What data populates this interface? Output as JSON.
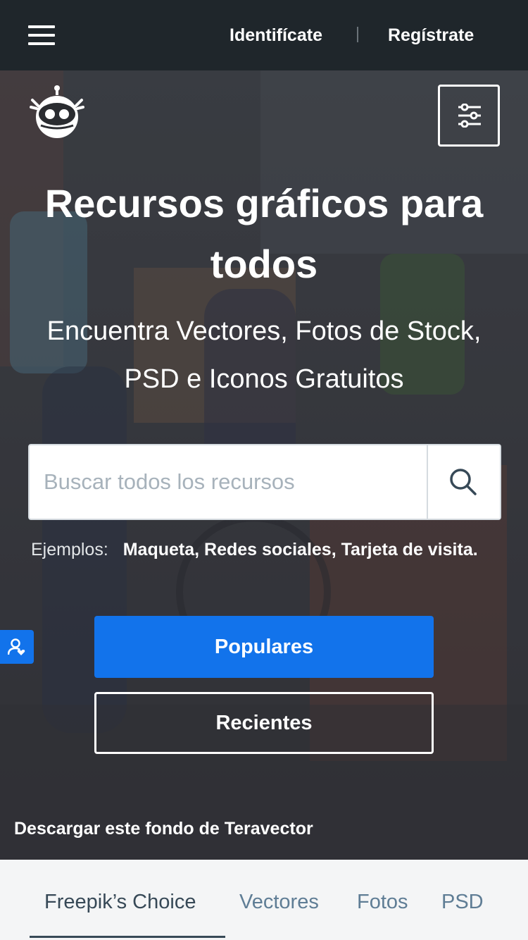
{
  "topbar": {
    "menu_icon": "hamburger-menu-icon",
    "login_label": "Identifícate",
    "register_label": "Regístrate"
  },
  "hero": {
    "logo_icon": "freepik-robot-logo-icon",
    "filter_icon": "sliders-icon",
    "title": "Recursos gráficos para todos",
    "subtitle": "Encuentra Vectores, Fotos de Stock, PSD e Iconos Gratuitos",
    "search": {
      "placeholder": "Buscar todos los recursos",
      "value": "",
      "button_icon": "search-icon"
    },
    "examples": {
      "label": "Ejemplos:",
      "items": [
        "Maqueta",
        "Redes sociales",
        "Tarjeta de visita"
      ],
      "separators": [
        ", ",
        ", ",
        "."
      ]
    },
    "user_tab_icon": "user-heart-icon",
    "popular_label": "Populares",
    "recent_label": "Recientes",
    "background_credit": "Descargar este fondo de Teravector"
  },
  "tabs": [
    {
      "label": "Freepik’s Choice",
      "active": true
    },
    {
      "label": "Vectores",
      "active": false
    },
    {
      "label": "Fotos",
      "active": false
    },
    {
      "label": "PSD",
      "active": false
    }
  ],
  "colors": {
    "topbar_bg": "#1f262b",
    "primary_blue": "#1273eb",
    "tab_active": "#374957",
    "tab_inactive": "#5f7d95"
  }
}
